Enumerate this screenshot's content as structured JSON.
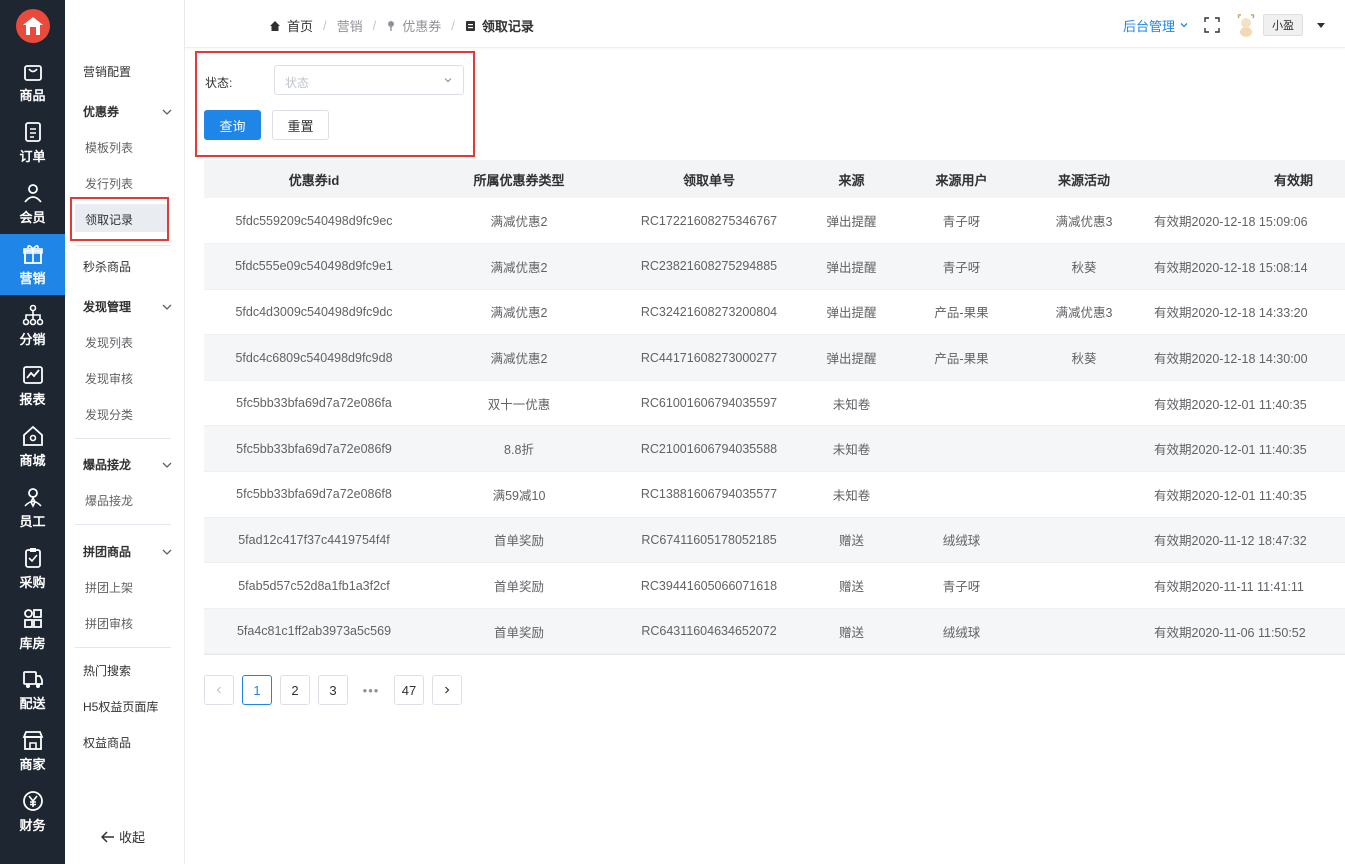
{
  "rail": {
    "items": [
      {
        "label": "商品",
        "icon": "bag-icon"
      },
      {
        "label": "订单",
        "icon": "order-icon"
      },
      {
        "label": "会员",
        "icon": "user-icon"
      },
      {
        "label": "营销",
        "icon": "gift-icon"
      },
      {
        "label": "分销",
        "icon": "network-icon"
      },
      {
        "label": "报表",
        "icon": "chart-icon"
      },
      {
        "label": "商城",
        "icon": "home-icon"
      },
      {
        "label": "员工",
        "icon": "staff-icon"
      },
      {
        "label": "采购",
        "icon": "clipboard-icon"
      },
      {
        "label": "库房",
        "icon": "grid-icon"
      },
      {
        "label": "配送",
        "icon": "truck-icon"
      },
      {
        "label": "商家",
        "icon": "store-icon"
      },
      {
        "label": "财务",
        "icon": "yen-icon"
      }
    ]
  },
  "subnav": {
    "marketing_config": "营销配置",
    "coupon_group": "优惠券",
    "template_list": "模板列表",
    "issue_list": "发行列表",
    "claim_records": "领取记录",
    "flash_sale": "秒杀商品",
    "discover_group": "发现管理",
    "discover_list": "发现列表",
    "discover_review": "发现审核",
    "discover_category": "发现分类",
    "hot_group": "爆品接龙",
    "hot_item": "爆品接龙",
    "group_buy_group": "拼团商品",
    "group_buy_shelf": "拼团上架",
    "group_buy_review": "拼团审核",
    "hot_search": "热门搜索",
    "h5_pages": "H5权益页面库",
    "benefit_goods": "权益商品",
    "collapse": "收起"
  },
  "header": {
    "breadcrumb": [
      "首页",
      "营销",
      "优惠券",
      "领取记录"
    ],
    "admin_menu": "后台管理",
    "username": "小盈"
  },
  "filter": {
    "status_label": "状态:",
    "status_placeholder": "状态",
    "query_button": "查询",
    "reset_button": "重置"
  },
  "table": {
    "columns": [
      "优惠券id",
      "所属优惠券类型",
      "领取单号",
      "来源",
      "来源用户",
      "来源活动",
      "有效期"
    ],
    "rows": [
      [
        "5fdc559209c540498d9fc9ec",
        "满减优惠2",
        "RC17221608275346767",
        "弹出提醒",
        "青子呀",
        "满减优惠3",
        "有效期2020-12-18 15:09:06"
      ],
      [
        "5fdc555e09c540498d9fc9e1",
        "满减优惠2",
        "RC23821608275294885",
        "弹出提醒",
        "青子呀",
        "秋葵",
        "有效期2020-12-18 15:08:14"
      ],
      [
        "5fdc4d3009c540498d9fc9dc",
        "满减优惠2",
        "RC32421608273200804",
        "弹出提醒",
        "产品-果果",
        "满减优惠3",
        "有效期2020-12-18 14:33:20"
      ],
      [
        "5fdc4c6809c540498d9fc9d8",
        "满减优惠2",
        "RC44171608273000277",
        "弹出提醒",
        "产品-果果",
        "秋葵",
        "有效期2020-12-18 14:30:00"
      ],
      [
        "5fc5bb33bfa69d7a72e086fa",
        "双十一优惠",
        "RC61001606794035597",
        "未知卷",
        "",
        "",
        "有效期2020-12-01 11:40:35"
      ],
      [
        "5fc5bb33bfa69d7a72e086f9",
        "8.8折",
        "RC21001606794035588",
        "未知卷",
        "",
        "",
        "有效期2020-12-01 11:40:35"
      ],
      [
        "5fc5bb33bfa69d7a72e086f8",
        "满59减10",
        "RC13881606794035577",
        "未知卷",
        "",
        "",
        "有效期2020-12-01 11:40:35"
      ],
      [
        "5fad12c417f37c4419754f4f",
        "首单奖励",
        "RC67411605178052185",
        "赠送",
        "绒绒球",
        "",
        "有效期2020-11-12 18:47:32"
      ],
      [
        "5fab5d57c52d8a1fb1a3f2cf",
        "首单奖励",
        "RC39441605066071618",
        "赠送",
        "青子呀",
        "",
        "有效期2020-11-11 11:41:11"
      ],
      [
        "5fa4c81c1ff2ab3973a5c569",
        "首单奖励",
        "RC64311604634652072",
        "赠送",
        "绒绒球",
        "",
        "有效期2020-11-06 11:50:52"
      ]
    ]
  },
  "pagination": {
    "pages": [
      "1",
      "2",
      "3"
    ],
    "ellipsis": "•••",
    "last": "47",
    "current": "1"
  },
  "colors": {
    "rail_bg": "#1d2631",
    "accent": "#1f86e8",
    "highlight": "#e53935"
  }
}
